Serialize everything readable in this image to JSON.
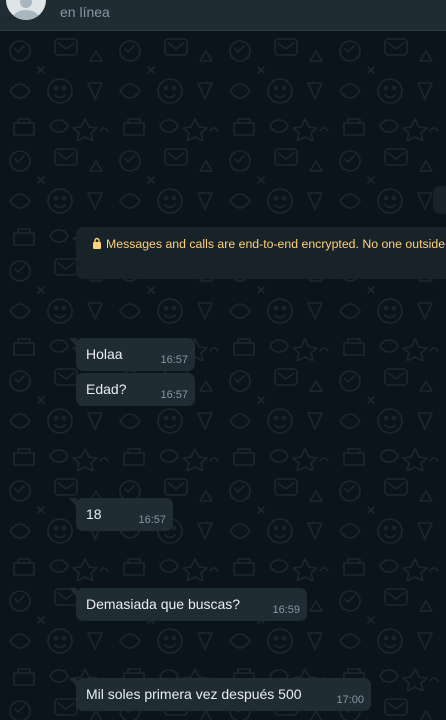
{
  "header": {
    "status": "en línea"
  },
  "encryption_notice": {
    "text": "Messages and calls are end-to-end encrypted. No one outside of this chat, not even WhatsApp, can read or listen to them."
  },
  "messages": [
    {
      "text": "Holaa",
      "time": "16:57"
    },
    {
      "text": "Edad?",
      "time": "16:57"
    },
    {
      "text": "18",
      "time": "16:57"
    },
    {
      "text": "Demasiada que buscas?",
      "time": "16:59"
    },
    {
      "text": "Mil soles primera vez después 500",
      "time": "17:00"
    }
  ],
  "colors": {
    "background": "#0b141a",
    "bubble": "#202c33",
    "encryption_text": "#ffd279",
    "time": "#8696a0"
  }
}
